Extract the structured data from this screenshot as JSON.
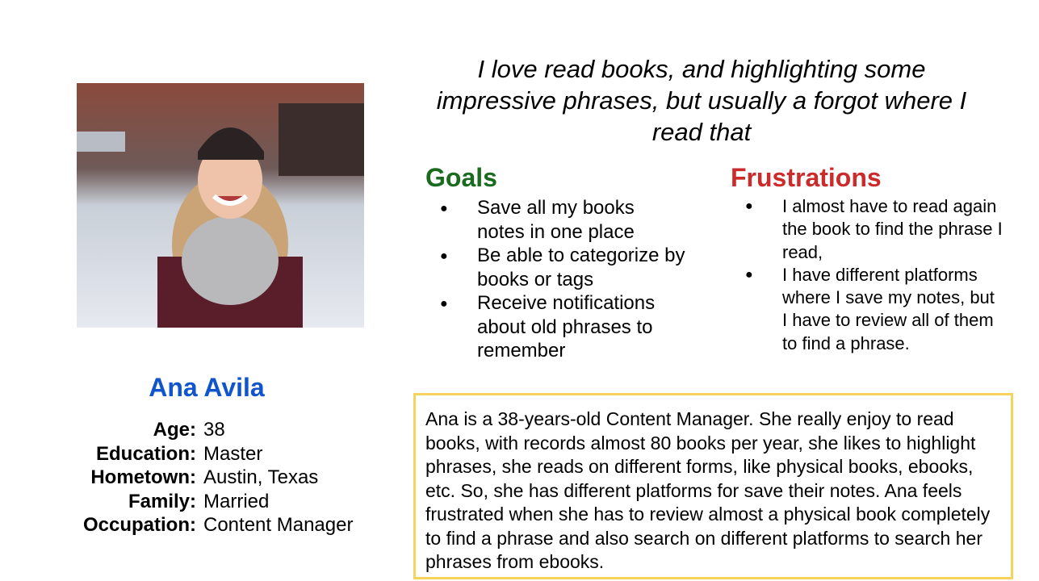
{
  "persona": {
    "name": "Ana Avila",
    "photo_icon": "persona-photo",
    "details": [
      {
        "label": "Age:",
        "value": "38"
      },
      {
        "label": "Education:",
        "value": "Master"
      },
      {
        "label": "Hometown:",
        "value": "Austin, Texas"
      },
      {
        "label": "Family:",
        "value": "Married"
      },
      {
        "label": "Occupation:",
        "value": "Content Manager"
      }
    ]
  },
  "quote": "I love read books, and highlighting some impressive phrases, but usually a forgot where I read that",
  "goals": {
    "title": "Goals",
    "items": [
      "Save all my books notes in one place",
      "Be able to categorize by books or tags",
      "Receive notifications about old phrases to remember"
    ]
  },
  "frustrations": {
    "title": "Frustrations",
    "items": [
      "I almost have to read again the book to find the phrase I read,",
      "I have different platforms where I save my notes, but I have to review all of them to find a phrase."
    ]
  },
  "summary": "Ana is a 38-years-old Content Manager. She really enjoy to read books, with records almost 80 books per year, she likes to highlight phrases, she reads on different forms, like physical books, ebooks, etc. So, she has different platforms for save their notes. Ana feels frustrated when she has to review almost a physical book completely to find a phrase and also search on different platforms to search her phrases from ebooks.",
  "colors": {
    "name": "#1155cc",
    "goals_title": "#1a6b1f",
    "frustrations_title": "#cc2b2b",
    "summary_border": "#f5d35c"
  }
}
